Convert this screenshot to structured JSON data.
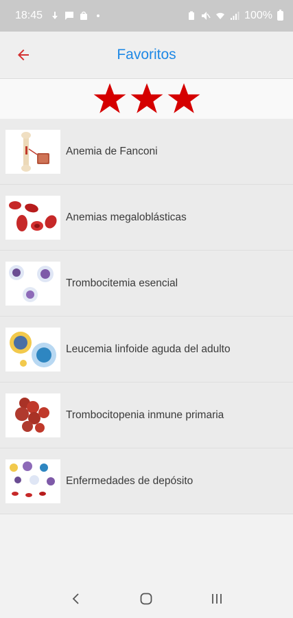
{
  "status_bar": {
    "time": "18:45",
    "battery": "100%",
    "icons": [
      "download-icon",
      "message-icon",
      "shopping-bag-icon",
      "dot-icon",
      "battery-saver-icon",
      "mute-icon",
      "wifi-icon",
      "signal-icon",
      "battery-icon"
    ]
  },
  "header": {
    "title": "Favoritos",
    "back_icon": "arrow-left-icon"
  },
  "rating": {
    "stars": 3,
    "color": "#d50000"
  },
  "favorites": [
    {
      "label": "Anemia de Fanconi",
      "icon": "bone-cells-thumbnail"
    },
    {
      "label": "Anemias megaloblásticas",
      "icon": "red-blood-cells-thumbnail"
    },
    {
      "label": "Trombocitemia esencial",
      "icon": "white-cells-thumbnail"
    },
    {
      "label": "Leucemia linfoide aguda del adulto",
      "icon": "lymphocytes-thumbnail"
    },
    {
      "label": "Trombocitopenia inmune primaria",
      "icon": "platelet-cluster-thumbnail"
    },
    {
      "label": "Enfermedades de depósito",
      "icon": "mixed-cells-thumbnail"
    }
  ],
  "nav_bar": {
    "buttons": [
      "back-nav-icon",
      "home-nav-icon",
      "recents-nav-icon"
    ]
  },
  "colors": {
    "accent": "#1e88e5",
    "back_arrow": "#d32f2f",
    "star": "#d50000",
    "status_bar": "#c9c9c9"
  }
}
